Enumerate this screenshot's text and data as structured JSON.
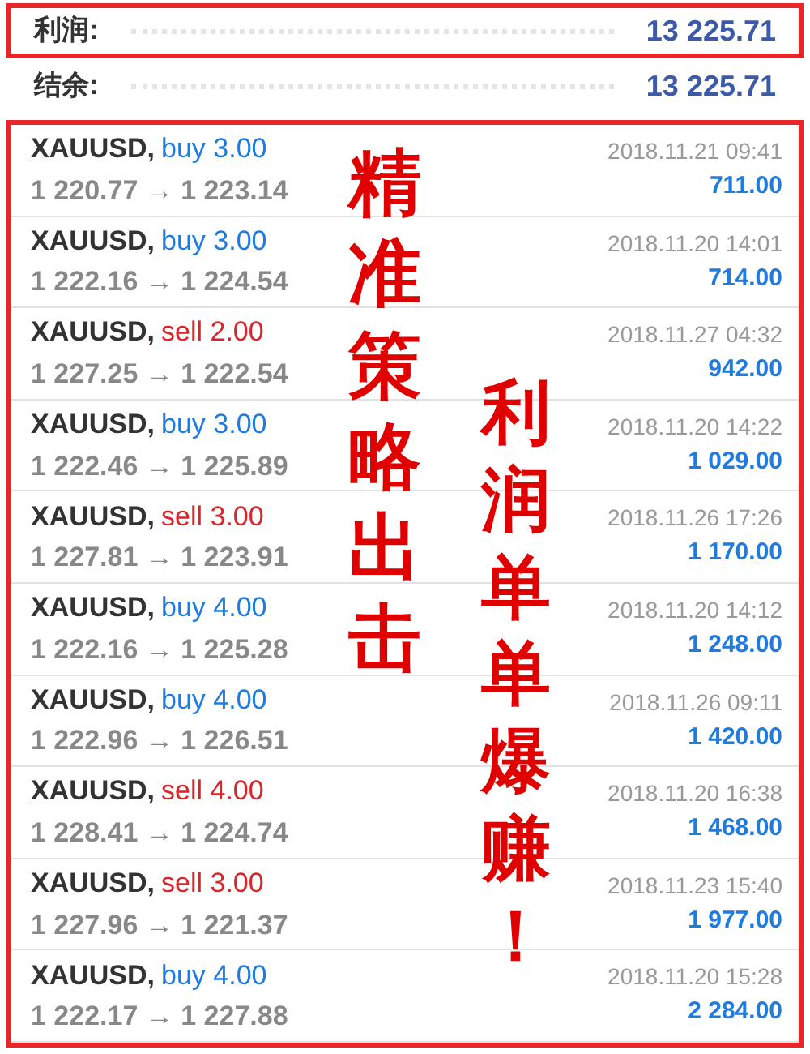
{
  "summary": [
    {
      "label": "利润:",
      "value": "13 225.71",
      "highlighted": true
    },
    {
      "label": "结余:",
      "value": "13 225.71",
      "highlighted": false
    }
  ],
  "trades": [
    {
      "symbol": "XAUUSD,",
      "color": "#1e7be0",
      "action": "buy 3.00",
      "prices": "1 220.77 → 1 223.14",
      "time": "2018.11.21 09:41",
      "profit": "711.00"
    },
    {
      "symbol": "XAUUSD,",
      "color": "#1e7be0",
      "action": "buy 3.00",
      "prices": "1 222.16 → 1 224.54",
      "time": "2018.11.20 14:01",
      "profit": "714.00"
    },
    {
      "symbol": "XAUUSD,",
      "color": "#d9262a",
      "action": "sell 2.00",
      "prices": "1 227.25 → 1 222.54",
      "time": "2018.11.27 04:32",
      "profit": "942.00"
    },
    {
      "symbol": "XAUUSD,",
      "color": "#1e7be0",
      "action": "buy 3.00",
      "prices": "1 222.46 → 1 225.89",
      "time": "2018.11.20 14:22",
      "profit": "1 029.00"
    },
    {
      "symbol": "XAUUSD,",
      "color": "#d9262a",
      "action": "sell 3.00",
      "prices": "1 227.81 → 1 223.91",
      "time": "2018.11.26 17:26",
      "profit": "1 170.00"
    },
    {
      "symbol": "XAUUSD,",
      "color": "#1e7be0",
      "action": "buy 4.00",
      "prices": "1 222.16 → 1 225.28",
      "time": "2018.11.20 14:12",
      "profit": "1 248.00"
    },
    {
      "symbol": "XAUUSD,",
      "color": "#1e7be0",
      "action": "buy 4.00",
      "prices": "1 222.96 → 1 226.51",
      "time": "2018.11.26 09:11",
      "profit": "1 420.00"
    },
    {
      "symbol": "XAUUSD,",
      "color": "#d9262a",
      "action": "sell 4.00",
      "prices": "1 228.41 → 1 224.74",
      "time": "2018.11.20 16:38",
      "profit": "1 468.00"
    },
    {
      "symbol": "XAUUSD,",
      "color": "#d9262a",
      "action": "sell 3.00",
      "prices": "1 227.96 → 1 221.37",
      "time": "2018.11.23 15:40",
      "profit": "1 977.00"
    },
    {
      "symbol": "XAUUSD,",
      "color": "#1e7be0",
      "action": "buy 4.00",
      "prices": "1 222.17 → 1 227.88",
      "time": "2018.11.20 15:28",
      "profit": "2 284.00"
    }
  ],
  "overlay_text": [
    "精准策略出击",
    "利润单单爆赚！"
  ]
}
